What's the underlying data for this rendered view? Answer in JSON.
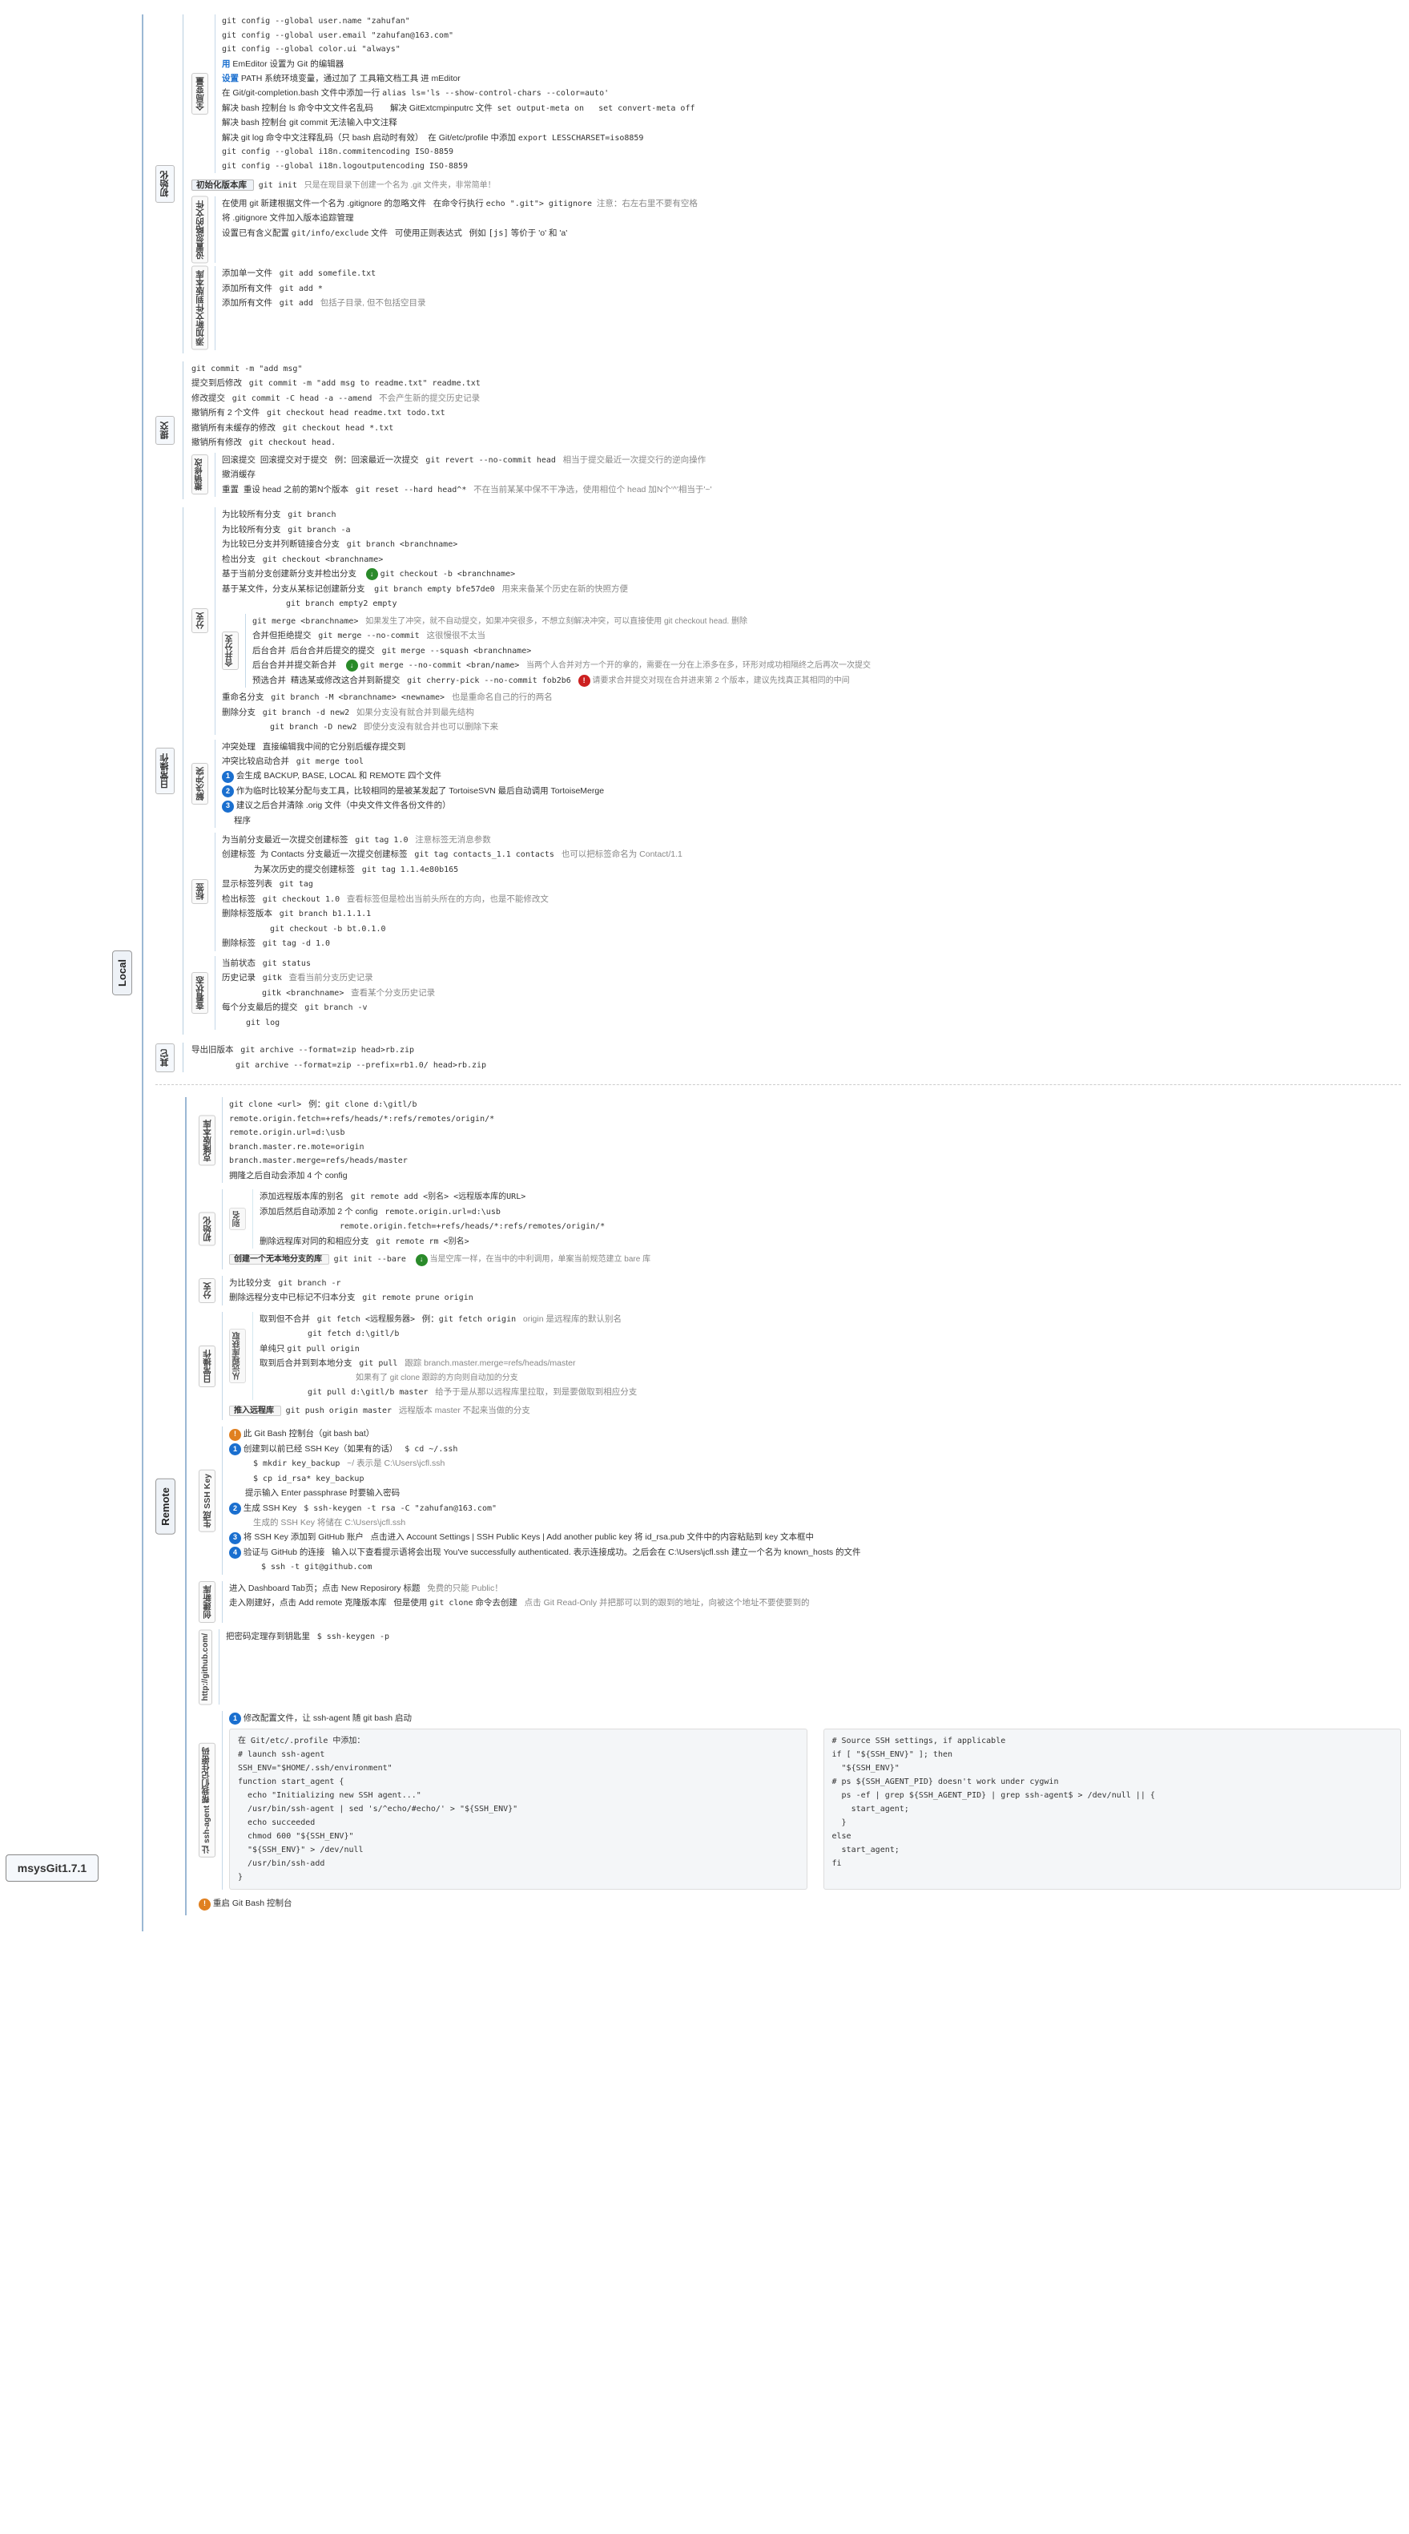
{
  "app": {
    "title": "msysGit1.7.1",
    "sections": {
      "local": "Local",
      "remote": "Remote"
    }
  },
  "local": {
    "init": {
      "label": "初始化",
      "global_vars": {
        "label": "全局变量",
        "lines": [
          "git config --global user.name \"zahufan\"",
          "git config --global user.email \"zahufan@163.com\"",
          "git config --global color.ui \"always\"",
          "用 EmEditor 设置为 Git 的编辑器",
          "设置 PATH 系统环境变量，通过加了 工具箱文档工具 进 mEditor",
          "在 Git/git-completion.bash 文件中添加一行 alias ls='ls --show-control-chars --color=auto'",
          "解决 bash 控制台 ls 命令中文文件名乱码",
          "解决 GitExtcmpinputrc 文件  set output-meta on  set convert-meta off",
          "解决 bash 控制台 git commit 无法输入中文注释",
          "解决 git log 命令中文注释乱码 (只 bash 启动时有效)",
          "在 Git/etc/profile 中添加 export LESSCHARSET=iso8859",
          "git config --global i18n.commitencoding ISO-8859",
          "git config --global i18n.logoutputencoding ISO-8859"
        ]
      },
      "init_version": {
        "label": "初始化版本库",
        "line": "git init    只是在现目录下创建一个名为 .git 文件夹，非常简单！"
      },
      "config_files": {
        "label": "设置忽略的文件",
        "lines": [
          "在使用 git 新建根据文件一个名为 .gitignore 的忽略文件    在命令行执行 echo \".git\"> gitignore    注意：右左右里不要有空格",
          "将 .gitignore 文件加入版本追踪管理",
          "设置已有含义配置 git/info/exclude 文件    可使用正则表达式    例如 [js] 等价于 'o' 和 'a'"
        ]
      },
      "add_files": {
        "label": "添加新文件到版本库",
        "lines": [
          "添加单一文件    git add somefile.txt",
          "添加所有文件    git add *",
          "添加所有文件    git add    包括子目录, 但不包括空目录"
        ]
      }
    },
    "commit": {
      "label": "提交",
      "lines": [
        "git commit -m \"add msg\"",
        "提交到后修改    git commit -m \"add msg to readme.txt\" readme.txt",
        "修改提交    git commit -C head -a --amend    不会产生新的提交历史记录",
        "撤销所有 2 个文件    git checkout head readme.txt todo.txt",
        "撤销所有未缓存的修改    git checkout head *.txt",
        "撤销所有修改    git checkout head.",
        "回滚提交    回滚提交对于提交    例：回滚最近一次提交    git revert --no-commit head    相当于提交最近一次提交行的逆向操作",
        "撤消缓存    重置    重设 head 之前的第N个版本    git reset --hard head^*    不在当前某某中保不干净选，该使用相位个 head 加N个'^'相当于'~'"
      ]
    },
    "branch": {
      "label": "分支",
      "lines": [
        "为比较所有分支    git branch",
        "为比较所有分支    git branch -a",
        "为比较已分支并列断链接合分支    git branch <branchname>",
        "检出分支    git checkout <branchname>",
        "基于当前分支创建新分支并检出分支    git checkout -b <branchname>",
        "基于某文件，分支从某标记创建新分支    git branch empty bfe57de0    用来来备某个历史在新的快照方便",
        "                                     git branch empty2 empty",
        "普通合并    合并到提交    git merge <branchname>    如果发生了冲突，就不自动提交，如果冲突很多，不想立刻解决冲突，可以直接使用 git checkout head. 删除",
        "             合并但拒绝提交    git merge --no-commit    这很慢很不太当",
        "后台合并    后台合并后提交的提交    git merge --squash <branchname>",
        "           后台合并并提交新合并    git merge --no-commit <bran/name>    当两个人合并对方一个开的拿的，需要在一分在上添多在多，环形对成功相隔终之后再次一次提交",
        "预选合并    精选某或修改这合并到新提交    git cherry-pick --no-commit fob2b6    请要求合并提交对现在合并进来第 2 个版本，建议先找真正其相同的中间",
        "重命名分支    git branch -M <branchname> <newname>    也是重命名自己的行的两名",
        "删除分支    git branch -d new2    如果分支没有就合并到最先结构",
        "           git branch -D new2    即使分支没有就合并也可以删除下来"
      ]
    },
    "conflict": {
      "label": "解决冲突",
      "lines": [
        "冲突处理    直接编辑我中间的它分别后缓存提交到",
        "冲突比较启动合并    git merge tool",
        "会生成 BACKUP, BASE, LOCAL 和 REMOTE 四个文件",
        "作为临时比较某分配与支工具，比较相同的是被某发起了 TortoiseSVN 最后自动调用 TortoiseMerge",
        "建议之后合并清除 .orig 文件 (中央文件文件各份文件的)",
        "程序"
      ]
    },
    "tags": {
      "label": "标签",
      "lines": [
        "为当前分支最近一次提交创建标签    git tag 1.0    注意标签无消息参数",
        "创建标签    为 Contacts 分支最近一次提交创建标签    git tag contacts_1.1 contacts    也可以把标签命名为 Contact/1.1",
        "         为某次历史的提交创建标签    git tag 1.1.4e80b165",
        "显示标签列表    git tag",
        "检出标签    git checkout 1.0    查看标签但是检出当前头所在的方向，也是不能修改文",
        "删除标签版本    git branch b1.1.1.1",
        "              git checkout -b bt.0.1.0",
        "删除标签    git tag -d 1.0"
      ]
    },
    "status": {
      "label": "查看状态",
      "lines": [
        "当前状态    git status",
        "历史记录    gitk    查看当前分支历史记录",
        "           gitk <branchname>    查看某个分支历史记录",
        "每个分支最后的提交    git branch -v"
      ]
    },
    "others": {
      "label": "其它",
      "lines": [
        "导出旧版本    git archive --format=zip head>rb.zip",
        "            git archive --format=zip --prefix=rb1.0/ head>rb.zip"
      ]
    }
  },
  "remote": {
    "clone": {
      "label": "克隆版本库",
      "lines": [
        "git clone <url>    例：git clone d:\\gitl/b",
        "remote.origin.fetch=+refs/heads/*:refs/remotes/origin/*",
        "remote.origin.url=d:\\usb",
        "branch.master.re.mote=origin",
        "branch.master.merge=refs/heads/master",
        "拥隆之后自动会添加 4 个 config"
      ]
    },
    "init": {
      "label": "初始化",
      "alias": {
        "label": "别名",
        "lines": [
          "git remote add <别名> <远程版本库的URL>    添加远程版本库的别名",
          "添加后然后自动添加 2 个 config    remote.origin.url=d:\\usb",
          "                               remote.origin.fetch=+refs/heads/*:refs/remotes/origin/*",
          "删除远程库对同的和相应分支    git remote rm <别名>"
        ]
      },
      "create_bare": {
        "label": "创建一个无本地分支的库",
        "line": "git init --bare    当是空库一样，在当中的中利调用，单案当前规范建立 bare 库"
      }
    },
    "branch": {
      "label": "分支",
      "lines": [
        "为比较分支    git branch -r",
        "删除远程分支中已标记不归本分支    git remote prune origin"
      ]
    },
    "daily": {
      "label": "日常操作",
      "fetch": {
        "label": "从远程库获取",
        "lines": [
          "取到但不合并    git fetch <远程服务器>    例：git fetch origin    origin 是远程库的默认别名",
          "              git fetch d:\\gitl/b",
          "单纯只 git pull origin",
          "取到后合并到到本地分支    git pull    跟踪 branch.master.merge=refs/heads/master",
          "                                       如果有了 git clone 跟踪的方向则自动加的分支",
          "                        git pull d:\\gitl/b master    给予于是从那以远程库里拉取，到是要做取到相应分支"
        ]
      },
      "push": {
        "label": "推入远程库",
        "line": "git push origin master    远程版本 master 不起来当做的分支"
      }
    },
    "ssh": {
      "label": "生成 SSH Key",
      "lines": [
        "此 Git Bash 控制台 ( git bash bat )",
        "创建到以前已经 SSH Key(如果有的话)    $ cd ~/.ssh",
        "                                      $ mkdir key_backup    ~/ 表示是 C:\\Users\\jcfl.ssh",
        "                                      $ cp id_rsa* key_backup",
        "                                      提示输入 Enter passphrase 时要输入密码",
        "生成 SSH Key    $ ssh-keygen -t rsa -C \"zahufan@163.com\"",
        "                生成的 SSH Key 将储在 C:\\Users\\jcfl.ssh",
        "将 SSH Key 添加到 GitHub 账户    点击进入 Account Settings | SSH Public Keys | Add another public key 将 id_rsa.pub 文件中的内容粘贴到 key 文本框中",
        "验证与 GitHub 的连接    输入以下查看提示语将会出现 You've successfully authenticated. 表示连接成功。之后会在 C:\\Users\\jcfl.ssh 建立一个名为 known_hosts 的文件",
        "                       $ ssh -t git@github.com"
      ]
    },
    "new_repo": {
      "label": "创建新库",
      "lines": [
        "进入 Dashboard Tab页；点击 New Reposirory 标题    免费的只能 Public！",
        "走入刚建好，点击 Add remote 克隆版本库    但是使用 git clone 命令去创建    点击 Git Read-Only 并把那可以到的跟到的地址，向被这个地址不要使要到的"
      ]
    },
    "http_github": {
      "label": "http://github.com/",
      "lines": [
        "把密码定理存到钥匙里    $ ssh-keygen -p"
      ]
    },
    "ssh_agent": {
      "label": "让 ssh-agent 帮我们记住密码",
      "code_block": [
        "在 Git/etc/.profile 中添加：",
        "# launch ssh-agent",
        "SSH_ENV=\"$HOME/.ssh/environment\"",
        "function start_agent {",
        "  echo \"Initializing new SSH agent...\"",
        "  /usr/bin/ssh-agent | sed 's/^echo/#echo/' > \"${SSH_ENV}\"",
        "  echo succeeded",
        "  chmod 600 \"${SSH_ENV}\"",
        "  \"${SSH_ENV}\" > /dev/null",
        "  /usr/bin/ssh-add",
        "}"
      ],
      "source_lines": [
        "# Source SSH settings, if applicable",
        "if [ \"${SSH_ENV}\" ]; then",
        "  \"${SSH_ENV}\"",
        "# ps ${SSH_AGENT_PID} doesn't work under cygwin",
        "  ps -ef | grep ${SSH_AGENT_PID} | grep ssh-agent$ > /dev/null || {",
        "    start_agent;",
        "  }",
        "else",
        "  start_agent;",
        "fi"
      ]
    },
    "restart": {
      "label": "重启 Git Bash 控制台"
    }
  }
}
